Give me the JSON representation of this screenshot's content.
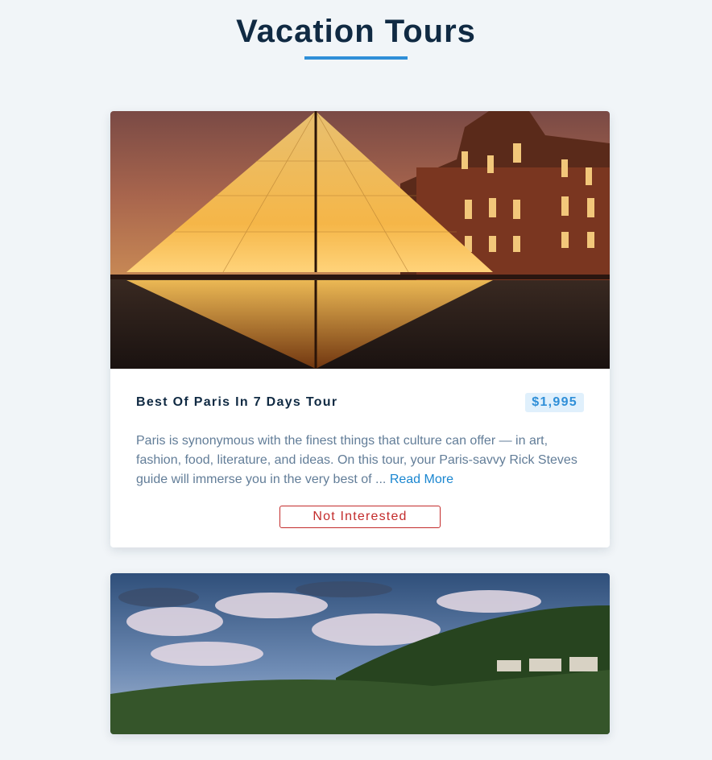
{
  "header": {
    "title": "Vacation Tours"
  },
  "tours": [
    {
      "name": "Best Of Paris In 7 Days Tour",
      "price": "$1,995",
      "description": "Paris is synonymous with the finest things that culture can offer — in art, fashion, food, literature, and ideas. On this tour, your Paris-savvy Rick Steves guide will immerse you in the very best of ...",
      "read_more_label": "Read More",
      "not_interested_label": "Not Interested",
      "image_icon": "louvre-pyramid-photo"
    },
    {
      "image_icon": "hillside-village-photo"
    }
  ],
  "colors": {
    "background": "#f1f5f8",
    "accent": "#2f8fd8",
    "title": "#102a43",
    "danger": "#c32b2b"
  }
}
